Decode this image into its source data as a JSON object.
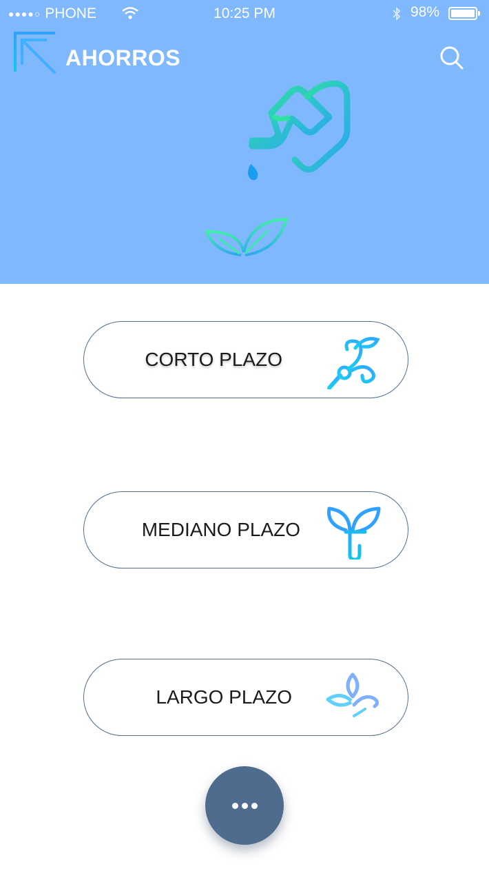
{
  "status_bar": {
    "carrier": "PHONE",
    "time": "10:25 PM",
    "battery": "98%"
  },
  "header": {
    "title": "AHORROS",
    "back_icon": "arrow-up-left-icon",
    "search_icon": "search-icon"
  },
  "hero": {
    "background_color": "#7fb8fc",
    "illustrations": [
      "watering-can-icon",
      "water-drop-icon",
      "sprout-icon"
    ]
  },
  "options": [
    {
      "label": "CORTO PLAZO",
      "icon": "seedling-curl-icon"
    },
    {
      "label": "MEDIANO PLAZO",
      "icon": "plant-leaves-icon"
    },
    {
      "label": "LARGO PLAZO",
      "icon": "plant-bud-icon"
    }
  ],
  "fab": {
    "icon": "more-icon",
    "color": "#4f6b8d"
  },
  "colors": {
    "accent_green": "#2fe3a0",
    "accent_blue": "#2aa4f4",
    "button_border": "#4f6f93"
  }
}
